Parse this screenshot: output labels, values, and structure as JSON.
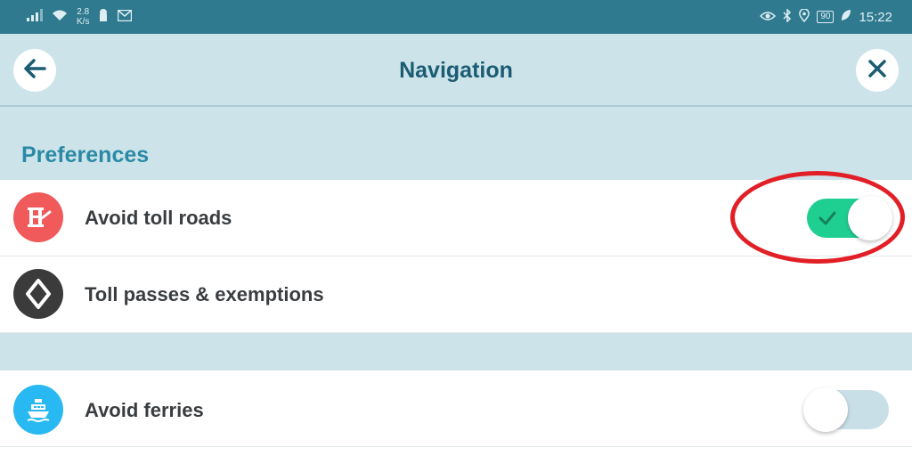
{
  "status_bar": {
    "speed_value": "2.8",
    "speed_unit": "K/s",
    "battery": "90",
    "time": "15:22"
  },
  "header": {
    "title": "Navigation",
    "back_icon": "arrow-left-icon",
    "close_icon": "close-icon"
  },
  "section": {
    "title": "Preferences"
  },
  "rows": [
    {
      "label": "Avoid toll roads",
      "icon": "toll-barrier-icon",
      "icon_color": "#f05a5a",
      "toggle": true
    },
    {
      "label": "Toll passes & exemptions",
      "icon": "diamond-sign-icon",
      "icon_color": "#3b3b3b"
    },
    {
      "label": "Avoid ferries",
      "icon": "ferry-icon",
      "icon_color": "#29b9f2",
      "toggle": false
    }
  ],
  "colors": {
    "accent": "#1b5c73",
    "toggle_on": "#1fcf91",
    "toggle_off": "#c9dfe7",
    "annotation": "#e21f26"
  }
}
